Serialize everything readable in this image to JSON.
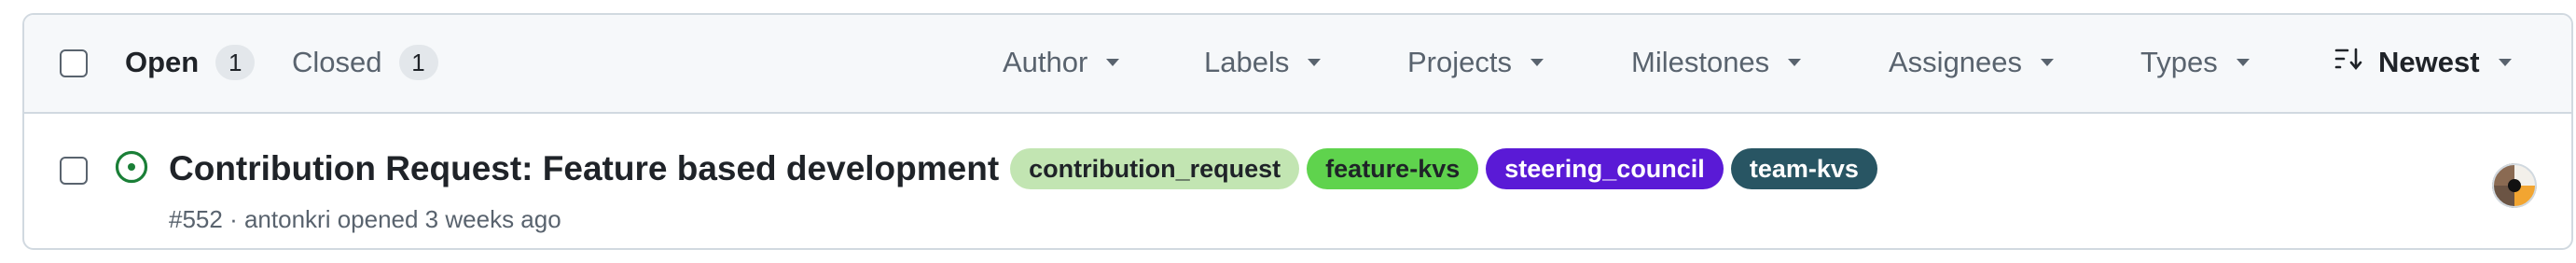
{
  "tabs": {
    "open": {
      "label": "Open",
      "count": "1"
    },
    "closed": {
      "label": "Closed",
      "count": "1"
    }
  },
  "filters": {
    "author": "Author",
    "labels": "Labels",
    "projects": "Projects",
    "milestones": "Milestones",
    "assignees": "Assignees",
    "types": "Types",
    "sort": "Newest"
  },
  "issue": {
    "title": "Contribution Request: Feature based development",
    "number": "#552",
    "author": "antonkri",
    "opened_text": "opened 3 weeks ago",
    "labels": [
      {
        "name": "contribution_request",
        "bg": "#c2e5b2",
        "fg": "#1f2328"
      },
      {
        "name": "feature-kvs",
        "bg": "#5fd34d",
        "fg": "#1f2328"
      },
      {
        "name": "steering_council",
        "bg": "#5a1ad6",
        "fg": "#ffffff"
      },
      {
        "name": "team-kvs",
        "bg": "#285563",
        "fg": "#ffffff"
      }
    ]
  },
  "colors": {
    "open_state": "#1a7f37",
    "header_bg": "#f6f8fa",
    "border": "#d1d9e0"
  },
  "icons": {
    "issue_state": "issue-opened-icon",
    "sort": "sort-desc-icon",
    "dropdown": "triangle-down-icon"
  }
}
